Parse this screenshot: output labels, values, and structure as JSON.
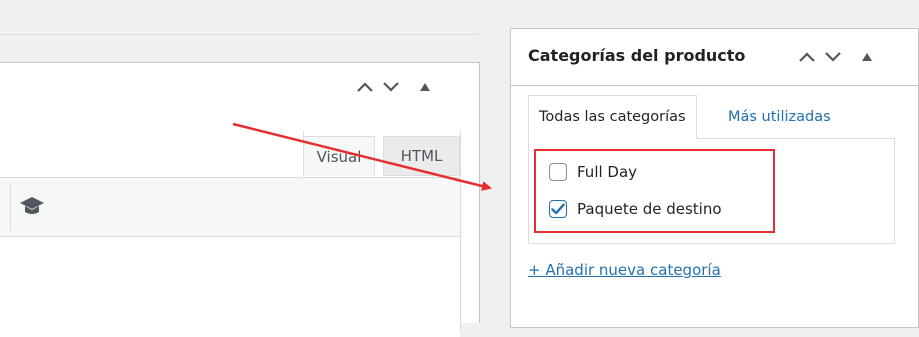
{
  "editor": {
    "tabs": {
      "visual": "Visual",
      "html": "HTML"
    },
    "toolbar_icon": "mortarboard-icon"
  },
  "metabox": {
    "title": "Categorías del producto",
    "tabs": {
      "all": "Todas las categorías",
      "most_used": "Más utilizadas"
    },
    "categories": [
      {
        "label": "Full Day",
        "checked": false
      },
      {
        "label": "Paquete de destino",
        "checked": true
      }
    ],
    "add_link": "+ Añadir nueva categoría"
  },
  "colors": {
    "accent": "#2271b1",
    "highlight": "#e62e2e",
    "background": "#f0f0f1"
  },
  "icons": [
    "chevron-up-icon",
    "chevron-down-icon",
    "collapse-triangle-icon",
    "checkmark-icon",
    "mortarboard-icon"
  ]
}
